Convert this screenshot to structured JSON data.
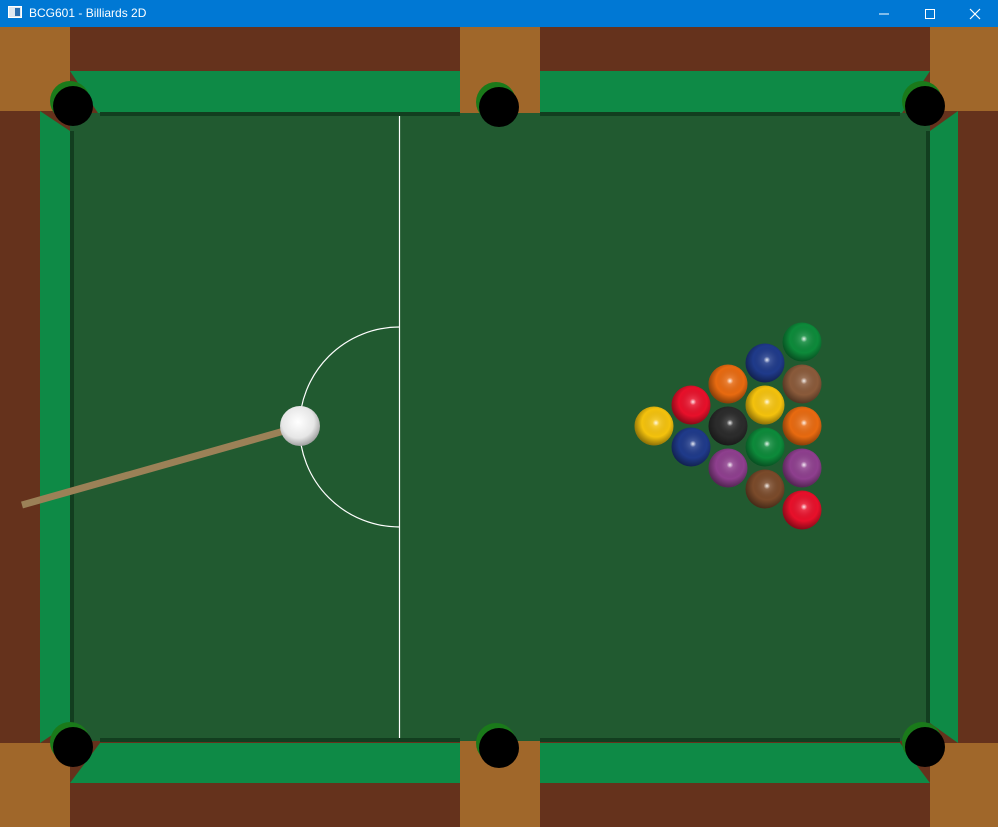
{
  "window": {
    "title": "BCG601 - Billiards 2D",
    "icon": "app-window-icon",
    "controls": {
      "minimize_icon": "minimize-icon",
      "maximize_icon": "maximize-icon",
      "close_icon": "close-icon"
    }
  },
  "table": {
    "colors": {
      "wood": "#65321c",
      "wood_corner": "#a0672a",
      "rail": "#0e8a46",
      "cloth": "#215a30",
      "cushion_edge": "#123e1f",
      "pocket": "#000000",
      "line": "#ffffff",
      "cue_stick": "#9b8157"
    },
    "pockets": [
      "top-left",
      "top-middle",
      "top-right",
      "bottom-left",
      "bottom-middle",
      "bottom-right"
    ]
  },
  "balls": {
    "cue_ball": {
      "color": "#f2f2f2"
    },
    "object_balls": [
      {
        "color": "#f4c20d"
      },
      {
        "color": "#e8102a"
      },
      {
        "color": "#1f3a8a"
      },
      {
        "color": "#e86a10"
      },
      {
        "color": "#2b2b2b"
      },
      {
        "color": "#8e3f8e"
      },
      {
        "color": "#1f3a8a"
      },
      {
        "color": "#f4c20d"
      },
      {
        "color": "#0d8a3a"
      },
      {
        "color": "#7a4a2a"
      },
      {
        "color": "#0d8a3a"
      },
      {
        "color": "#8a5a3a"
      },
      {
        "color": "#e86a10"
      },
      {
        "color": "#8e3f8e"
      },
      {
        "color": "#e8102a"
      }
    ]
  }
}
